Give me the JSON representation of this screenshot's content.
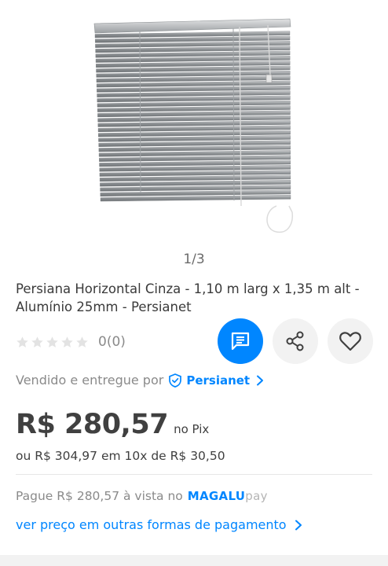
{
  "gallery": {
    "image_alt": "Persiana Horizontal Cinza",
    "counter": "1/3"
  },
  "product": {
    "title": "Persiana Horizontal Cinza -  1,10 m larg x 1,35 m alt - Alumínio 25mm - Persianet"
  },
  "rating": {
    "stars": 0,
    "max": 5,
    "text": "0(0)"
  },
  "actions": {
    "chat_icon": "chat-icon",
    "share_icon": "share-icon",
    "favorite_icon": "heart-icon"
  },
  "seller": {
    "label": "Vendido e entregue por",
    "name": "Persianet"
  },
  "price": {
    "value": "R$ 280,57",
    "suffix": "no Pix",
    "installments": "ou R$ 304,97 em 10x de R$ 30,50"
  },
  "pix": {
    "text": "Pague R$ 280,57 à vista no",
    "brand_strong": "MAGALU",
    "brand_light": "pay"
  },
  "payment": {
    "link": "ver preço em outras formas de pagamento"
  },
  "colors": {
    "accent": "#0086ff",
    "text": "#404040",
    "muted": "#8a8a8a",
    "button_bg": "#f2f2f2"
  }
}
